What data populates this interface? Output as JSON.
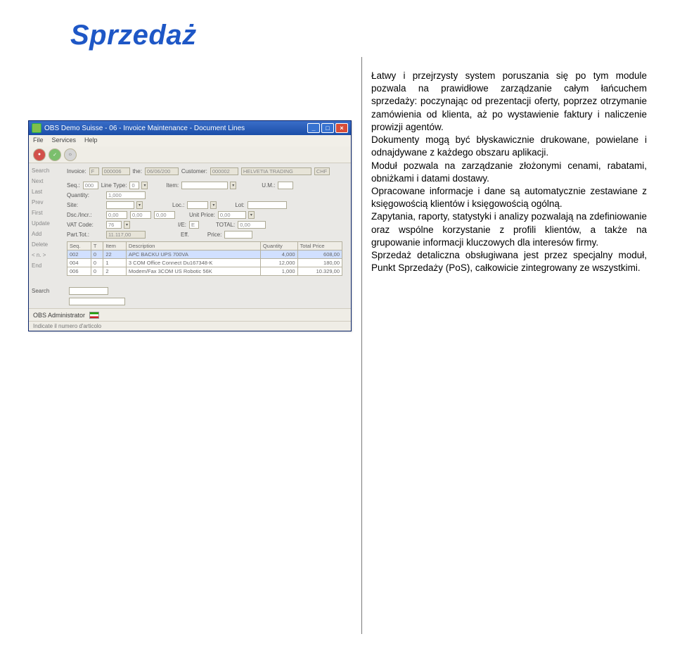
{
  "document": {
    "title": "Sprzedaż",
    "paragraphs": [
      "Łatwy i przejrzysty system poruszania się po tym module pozwala na prawidłowe zarządzanie całym łańcuchem sprzedaży: poczynając od prezentacji oferty, poprzez otrzymanie zamówienia od klienta, aż po wystawienie faktury i naliczenie prowizji agentów.",
      "Dokumenty mogą być błyskawicznie drukowane, powielane i odnajdywane z każdego obszaru aplikacji.",
      "Moduł pozwala na zarządzanie złożonymi cenami, rabatami, obniżkami i datami dostawy.",
      "Opracowane informacje i dane są automatycznie zestawiane z księgowością klientów i księgowością ogólną.",
      "Zapytania, raporty, statystyki i analizy pozwalają na zdefiniowanie oraz wspólne korzystanie z profili klientów, a także na grupowanie informacji kluczowych dla interesów firmy.",
      "Sprzedaż detaliczna obsługiwana jest przez specjalny moduł, Punkt Sprzedaży (PoS), całkowicie zintegrowany ze wszystkimi."
    ]
  },
  "window": {
    "title": "OBS Demo Suisse - 06 - Invoice Maintenance - Document Lines",
    "menus": [
      "File",
      "Services",
      "Help"
    ],
    "sidebar_items": [
      "Search",
      "Next",
      "Last",
      "Prev",
      "First",
      "Update",
      "Add",
      "Delete",
      "< n. >",
      "End"
    ],
    "sidebar_search_label": "Search",
    "status_user": "OBS Administrator",
    "status_hint": "Indicate il numero d'articolo",
    "header": {
      "invoice_label": "Invoice:",
      "invoice_prefix": "F",
      "invoice_no": "000006",
      "the_label": "the:",
      "the_date": "06/06/200",
      "customer_label": "Customer:",
      "customer_code": "000002",
      "customer_name": "HELVETIA TRADING",
      "currency": "CHF"
    },
    "line": {
      "seq_label": "Seq.:",
      "seq": "000",
      "linetype_label": "Line Type:",
      "linetype": "0",
      "item_label": "Item:",
      "um_label": "U.M.:",
      "qty_label": "Quantity:",
      "qty": "1,000",
      "site_label": "Site:",
      "loc_label": "Loc.:",
      "lot_label": "Lot:",
      "dsc_label": "Dsc./Incr.:",
      "dsc1": "0,00",
      "dsc2": "0,00",
      "dsc3": "0,00",
      "up_label": "Unit Price:",
      "up": "0,00",
      "vat_label": "VAT Code:",
      "vat": "76",
      "ie_label": "I/E:",
      "ie": "E",
      "total_label": "TOTAL:",
      "total": "0,00",
      "part_label": "Part.Tot.:",
      "part": "11.117,00",
      "eff_label": "Eff.",
      "price_label": "Price:"
    },
    "table": {
      "cols": [
        "Seq.",
        "T",
        "Item",
        "Description",
        "Quantity",
        "Total Price"
      ],
      "rows": [
        {
          "seq": "002",
          "t": "0",
          "item": "22",
          "desc": "APC BACKU UPS 700VA",
          "qty": "4,000",
          "total": "608,00",
          "sel": true
        },
        {
          "seq": "004",
          "t": "0",
          "item": "1",
          "desc": "3 COM Office Connect Du167348-K",
          "qty": "12,000",
          "total": "180,00",
          "sel": false
        },
        {
          "seq": "006",
          "t": "0",
          "item": "2",
          "desc": "Modem/Fax 3COM US Robotic 56K",
          "qty": "1,000",
          "total": "10.329,00",
          "sel": false
        }
      ]
    }
  }
}
